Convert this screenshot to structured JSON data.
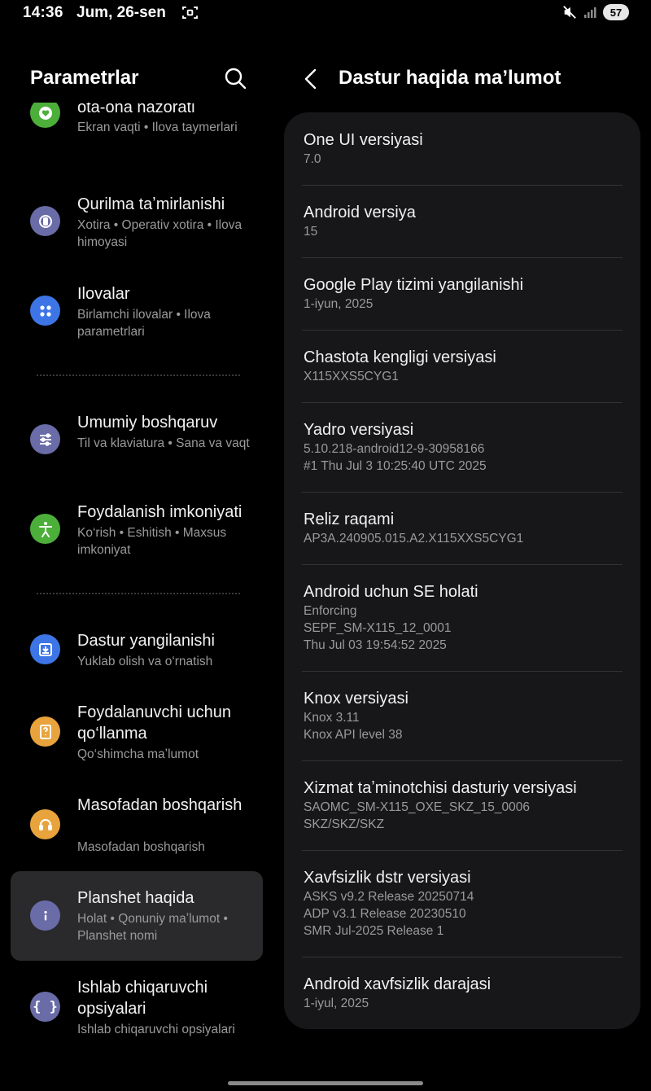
{
  "status_bar": {
    "time": "14:36",
    "date": "Jum, 26-sen",
    "battery": "57",
    "icons": [
      "screenshot-icon",
      "mute-icon",
      "signal-icon"
    ]
  },
  "left": {
    "title": "Parametrlar",
    "items": [
      {
        "title": "ota-ona nazorati",
        "subtitle": "Ekran vaqti  •  Ilova taymerlari",
        "icon": "heart-icon",
        "color": "#4caf3a"
      },
      {
        "title": "Qurilma taʼmirlanishi",
        "subtitle": "Xotira  •  Operativ xotira  •  Ilova himoyasi",
        "icon": "device-care-icon",
        "color": "#6a6ca8"
      },
      {
        "title": "Ilovalar",
        "subtitle": "Birlamchi ilovalar  •  Ilova parametrlari",
        "icon": "apps-icon",
        "color": "#3d75e6"
      },
      {
        "title": "Umumiy boshqaruv",
        "subtitle": "Til va klaviatura  •  Sana va vaqt",
        "icon": "sliders-icon",
        "color": "#6a6ca8"
      },
      {
        "title": "Foydalanish imkoniyati",
        "subtitle": "Ko‘rish  •  Eshitish  •  Maxsus imkoniyat",
        "icon": "accessibility-icon",
        "color": "#4caf3a"
      },
      {
        "title": "Dastur yangilanishi",
        "subtitle": "Yuklab olish va o‘rnatish",
        "icon": "download-icon",
        "color": "#3d75e6"
      },
      {
        "title": "Foydalanuvchi uchun qo‘llanma",
        "subtitle": "Qo‘shimcha maʼlumot",
        "icon": "manual-icon",
        "color": "#e8a33c"
      },
      {
        "title": "Masofadan boshqarish",
        "subtitle": "Masofadan boshqarish",
        "icon": "headset-icon",
        "color": "#e8a33c"
      },
      {
        "title": "Planshet haqida",
        "subtitle": "Holat  •  Qonuniy maʼlumot  •  Planshet nomi",
        "icon": "info-icon",
        "color": "#6a6ca8"
      },
      {
        "title": "Ishlab chiqaruvchi opsiyalari",
        "subtitle": "Ishlab chiqaruvchi opsiyalari",
        "icon": "braces-icon",
        "color": "#6a6ca8"
      }
    ]
  },
  "right": {
    "title": "Dastur haqida maʼlumot",
    "rows": [
      {
        "label": "One UI versiyasi",
        "values": [
          "7.0"
        ]
      },
      {
        "label": "Android versiya",
        "values": [
          "15"
        ]
      },
      {
        "label": "Google Play tizimi yangilanishi",
        "values": [
          "1-iyun, 2025"
        ]
      },
      {
        "label": "Chastota kengligi versiyasi",
        "values": [
          "X115XXS5CYG1"
        ]
      },
      {
        "label": "Yadro versiyasi",
        "values": [
          "5.10.218-android12-9-30958166",
          "#1 Thu Jul 3 10:25:40 UTC 2025"
        ]
      },
      {
        "label": "Reliz raqami",
        "values": [
          "AP3A.240905.015.A2.X115XXS5CYG1"
        ]
      },
      {
        "label": "Android uchun SE holati",
        "values": [
          "Enforcing",
          "SEPF_SM-X115_12_0001",
          "Thu Jul 03 19:54:52 2025"
        ]
      },
      {
        "label": "Knox versiyasi",
        "values": [
          "Knox 3.11",
          "Knox API level 38"
        ]
      },
      {
        "label": "Xizmat taʼminotchisi dasturiy versiyasi",
        "values": [
          "SAOMC_SM-X115_OXE_SKZ_15_0006",
          "SKZ/SKZ/SKZ"
        ]
      },
      {
        "label": "Xavfsizlik dstr versiyasi",
        "values": [
          "ASKS v9.2  Release 20250714",
          "ADP v3.1 Release 20230510",
          "SMR Jul-2025 Release 1"
        ]
      },
      {
        "label": "Android xavfsizlik darajasi",
        "values": [
          "1-iyul, 2025"
        ]
      }
    ]
  }
}
